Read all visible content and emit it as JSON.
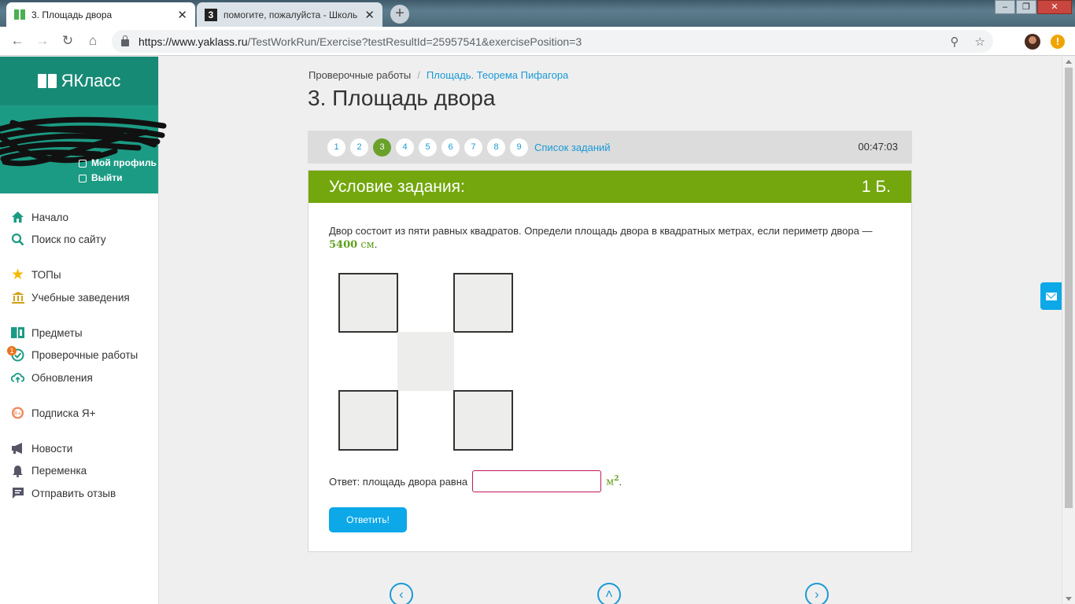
{
  "browser": {
    "tabs": [
      {
        "title": "3. Площадь двора",
        "active": true
      },
      {
        "title": "помогите, пожалуйста - Школьн",
        "active": false
      }
    ],
    "new_tab": "+",
    "url_host": "https://www.yaklass.ru",
    "url_path": "/TestWorkRun/Exercise?testResultId=25957541&exercisePosition=3",
    "alert_badge": "!"
  },
  "sidebar": {
    "logo": "ЯКласс",
    "profile_links": [
      "Мой профиль",
      "Выйти"
    ],
    "items": [
      {
        "label": "Начало",
        "icon": "home-icon"
      },
      {
        "label": "Поиск по сайту",
        "icon": "search-icon"
      },
      {
        "label": "ТОПы",
        "icon": "star-icon"
      },
      {
        "label": "Учебные заведения",
        "icon": "institution-icon"
      },
      {
        "label": "Предметы",
        "icon": "book-icon"
      },
      {
        "label": "Проверочные работы",
        "icon": "check-icon",
        "badge": "1"
      },
      {
        "label": "Обновления",
        "icon": "cloud-icon"
      },
      {
        "label": "Подписка Я+",
        "icon": "subscription-icon"
      },
      {
        "label": "Новости",
        "icon": "megaphone-icon"
      },
      {
        "label": "Переменка",
        "icon": "bell-icon"
      },
      {
        "label": "Отправить отзыв",
        "icon": "feedback-icon"
      }
    ]
  },
  "breadcrumb": {
    "root": "Проверочные работы",
    "separator": "/",
    "current": "Площадь. Теорема Пифагора"
  },
  "page_title": "3. Площадь двора",
  "pager": {
    "numbers": [
      "1",
      "2",
      "3",
      "4",
      "5",
      "6",
      "7",
      "8",
      "9"
    ],
    "current": "3",
    "task_list_label": "Список заданий",
    "timer": "00:47:03"
  },
  "task": {
    "header": "Условие задания:",
    "points": "1 Б.",
    "text_before": "Двор состоит из пяти равных квадратов. Определи площадь двора в квадратных метрах, если периметр двора —",
    "perimeter_value": "5400",
    "perimeter_unit": "см",
    "text_after": ".",
    "answer_label": "Ответ: площадь двора равна",
    "answer_value": "",
    "unit": "м",
    "unit_power": "2",
    "unit_suffix": ".",
    "submit_label": "Ответить!"
  },
  "colors": {
    "accent_green": "#73a70d",
    "sidebar_teal": "#1c9b84",
    "link_blue": "#1a9ad6",
    "button_blue": "#0da8e8"
  }
}
